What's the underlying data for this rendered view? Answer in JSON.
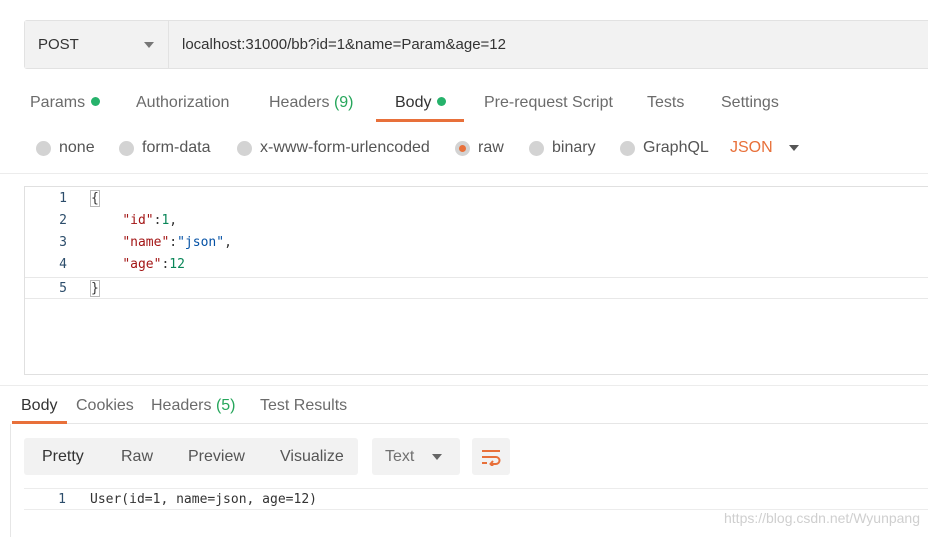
{
  "request": {
    "method": "POST",
    "url": "localhost:31000/bb?id=1&name=Param&age=12"
  },
  "request_tabs": [
    {
      "label": "Params"
    },
    {
      "label": "Authorization"
    },
    {
      "label": "Headers",
      "count": "(9)"
    },
    {
      "label": "Body"
    },
    {
      "label": "Pre-request Script"
    },
    {
      "label": "Tests"
    },
    {
      "label": "Settings"
    }
  ],
  "body_types": [
    "none",
    "form-data",
    "x-www-form-urlencoded",
    "raw",
    "binary",
    "GraphQL"
  ],
  "body_type_selected": "raw",
  "language": "JSON",
  "editor_lines": [
    {
      "n": "1",
      "text": "{"
    },
    {
      "n": "2",
      "key": "\"id\"",
      "sep": ":",
      "val": "1",
      "tail": ","
    },
    {
      "n": "3",
      "key": "\"name\"",
      "sep": ":",
      "val": "\"json\"",
      "tail": ","
    },
    {
      "n": "4",
      "key": "\"age\"",
      "sep": ":",
      "val": "12",
      "tail": ""
    },
    {
      "n": "5",
      "text": "}"
    }
  ],
  "response_tabs": [
    {
      "label": "Body"
    },
    {
      "label": "Cookies"
    },
    {
      "label": "Headers",
      "count": "(5)"
    },
    {
      "label": "Test Results"
    }
  ],
  "view_modes": [
    "Pretty",
    "Raw",
    "Preview",
    "Visualize"
  ],
  "format_select": "Text",
  "response_lines": [
    {
      "n": "1",
      "text": "User(id=1, name=json, age=12)"
    }
  ],
  "watermark": "https://blog.csdn.net/Wyunpang",
  "colors": {
    "accent": "#e8703a",
    "green": "#26b26b"
  }
}
